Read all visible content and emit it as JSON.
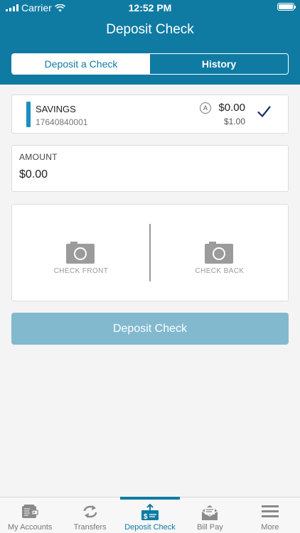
{
  "status_bar": {
    "carrier": "Carrier",
    "time": "12:52 PM"
  },
  "header": {
    "title": "Deposit Check"
  },
  "segments": [
    {
      "label": "Deposit a Check",
      "active": true
    },
    {
      "label": "History",
      "active": false
    }
  ],
  "account": {
    "name": "SAVINGS",
    "number": "17640840001",
    "available_icon_letter": "A",
    "balance": "$0.00",
    "secondary_balance": "$1.00"
  },
  "amount": {
    "label": "AMOUNT",
    "value": "$0.00"
  },
  "photos": {
    "front_label": "CHECK FRONT",
    "back_label": "CHECK BACK"
  },
  "deposit_button": {
    "label": "Deposit Check"
  },
  "tabs": [
    {
      "label": "My Accounts",
      "icon": "wallet-icon",
      "active": false
    },
    {
      "label": "Transfers",
      "icon": "transfer-icon",
      "active": false
    },
    {
      "label": "Deposit Check",
      "icon": "deposit-check-icon",
      "active": true
    },
    {
      "label": "Bill Pay",
      "icon": "bill-pay-icon",
      "active": false
    },
    {
      "label": "More",
      "icon": "menu-icon",
      "active": false
    }
  ],
  "colors": {
    "brand": "#0f7ba3",
    "button_disabled": "#82b9cf",
    "account_bar": "#1a8fc1",
    "check_mark": "#1c2b6b"
  }
}
